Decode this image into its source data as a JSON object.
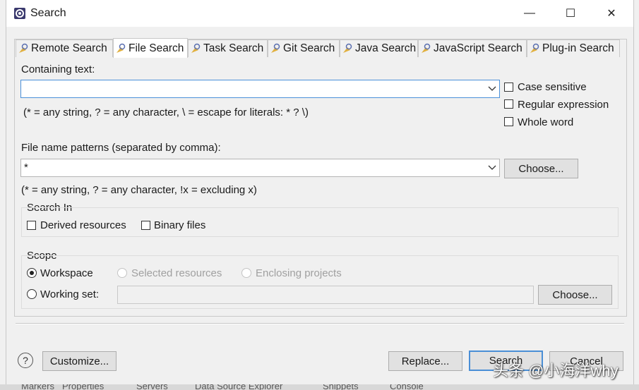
{
  "window": {
    "title": "Search",
    "controls": {
      "minimize": "—",
      "maximize": "☐",
      "close": "✕"
    }
  },
  "tabs": [
    {
      "label": "Remote Search",
      "active": false
    },
    {
      "label": "File Search",
      "active": true
    },
    {
      "label": "Task Search",
      "active": false
    },
    {
      "label": "Git Search",
      "active": false
    },
    {
      "label": "Java Search",
      "active": false
    },
    {
      "label": "JavaScript Search",
      "active": false
    },
    {
      "label": "Plug-in Search",
      "active": false
    }
  ],
  "containing_text": {
    "label": "Containing text:",
    "value": "",
    "hint": "(* = any string, ? = any character, \\ = escape for literals: * ? \\)"
  },
  "options": {
    "case_sensitive": {
      "label": "Case sensitive",
      "checked": false
    },
    "regular_expression": {
      "label": "Regular expression",
      "checked": false
    },
    "whole_word": {
      "label": "Whole word",
      "checked": false
    }
  },
  "file_patterns": {
    "label": "File name patterns (separated by comma):",
    "value": "*",
    "choose_label": "Choose...",
    "hint": "(* = any string, ? = any character, !x = excluding x)"
  },
  "search_in": {
    "title": "Search In",
    "derived": {
      "label": "Derived resources",
      "checked": false
    },
    "binary": {
      "label": "Binary files",
      "checked": false
    }
  },
  "scope": {
    "title": "Scope",
    "workspace": {
      "label": "Workspace",
      "selected": true
    },
    "selected_resources": {
      "label": "Selected resources",
      "enabled": false
    },
    "enclosing_projects": {
      "label": "Enclosing projects",
      "enabled": false
    },
    "working_set": {
      "label": "Working set:",
      "value": ""
    },
    "choose_label": "Choose..."
  },
  "footer": {
    "help": "?",
    "customize": "Customize...",
    "replace": "Replace...",
    "search": "Search",
    "cancel": "Cancel"
  },
  "background_views": [
    "Markers",
    "Properties",
    "Servers",
    "Data Source Explorer",
    "Snippets",
    "Console"
  ],
  "watermark": "头条 @小海洋why",
  "colors": {
    "accent": "#4a8fd6",
    "dialog_bg": "#f0f0f0"
  }
}
